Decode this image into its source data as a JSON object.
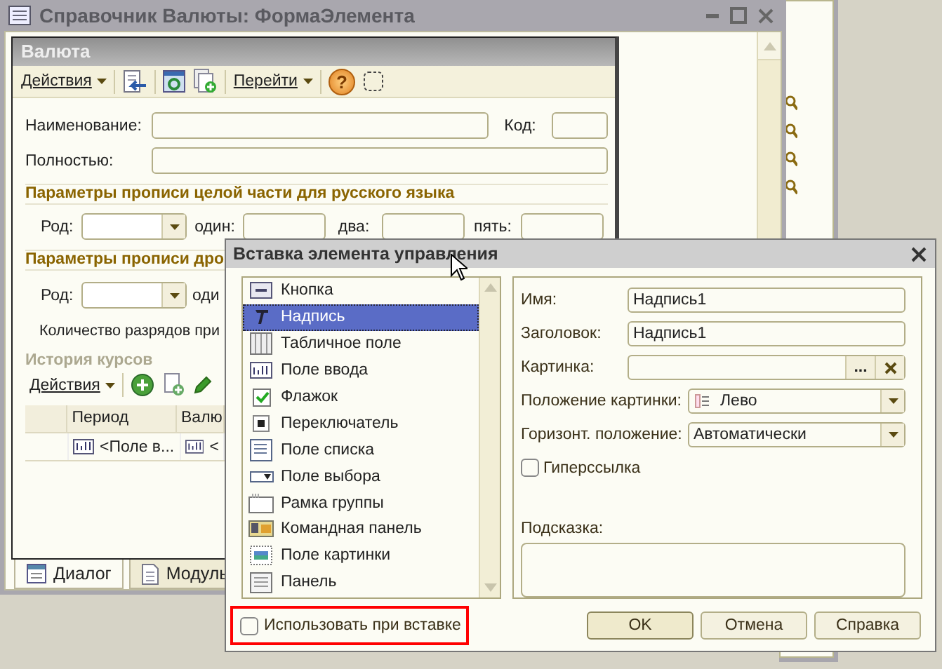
{
  "main_window": {
    "title": "Справочник Валюты: ФормаЭлемента"
  },
  "form": {
    "title": "Валюта",
    "toolbar_menus": [
      "Действия",
      "Перейти"
    ],
    "help_glyph": "?",
    "name_label": "Наименование:",
    "code_label": "Код:",
    "full_label": "Полностью:",
    "sections": [
      {
        "title": "Параметры прописи целой части для русского языка",
        "gender_label": "Род:",
        "labels": [
          "один:",
          "два:",
          "пять:"
        ]
      },
      {
        "title": "Параметры прописи дро",
        "gender_label": "Род:",
        "labels": [
          "оди"
        ],
        "note": "Количество разрядов при"
      }
    ],
    "history": {
      "title": "История курсов",
      "toolbar_menu": "Действия",
      "columns": [
        "Период",
        "Валю"
      ],
      "rows": [
        [
          "<Поле в...",
          "<"
        ]
      ]
    },
    "tabs": [
      {
        "label": "Диалог",
        "selected": true
      },
      {
        "label": "Модуль",
        "selected": false
      }
    ]
  },
  "dialog": {
    "title": "Вставка элемента управления",
    "elements": [
      {
        "label": "Кнопка",
        "selected": false
      },
      {
        "label": "Надпись",
        "selected": true
      },
      {
        "label": "Табличное поле",
        "selected": false
      },
      {
        "label": "Поле ввода",
        "selected": false
      },
      {
        "label": "Флажок",
        "selected": false
      },
      {
        "label": "Переключатель",
        "selected": false
      },
      {
        "label": "Поле списка",
        "selected": false
      },
      {
        "label": "Поле выбора",
        "selected": false
      },
      {
        "label": "Рамка группы",
        "selected": false
      },
      {
        "label": "Командная панель",
        "selected": false
      },
      {
        "label": "Поле картинки",
        "selected": false
      },
      {
        "label": "Панель",
        "selected": false
      }
    ],
    "properties": {
      "name": {
        "label": "Имя:",
        "value": "Надпись1"
      },
      "caption": {
        "label": "Заголовок:",
        "value": "Надпись1"
      },
      "picture": {
        "label": "Картинка:",
        "browse": "..."
      },
      "picture_position": {
        "label": "Положение картинки:",
        "value": "Лево"
      },
      "horizontal_position": {
        "label": "Горизонт. положение:",
        "value": "Автоматически"
      },
      "hyperlink": {
        "label": "Гиперссылка",
        "checked": false
      },
      "tooltip": {
        "label": "Подсказка:"
      }
    },
    "use_on_insert": {
      "label": "Использовать при вставке",
      "checked": false
    },
    "buttons": [
      "OK",
      "Отмена",
      "Справка"
    ]
  }
}
